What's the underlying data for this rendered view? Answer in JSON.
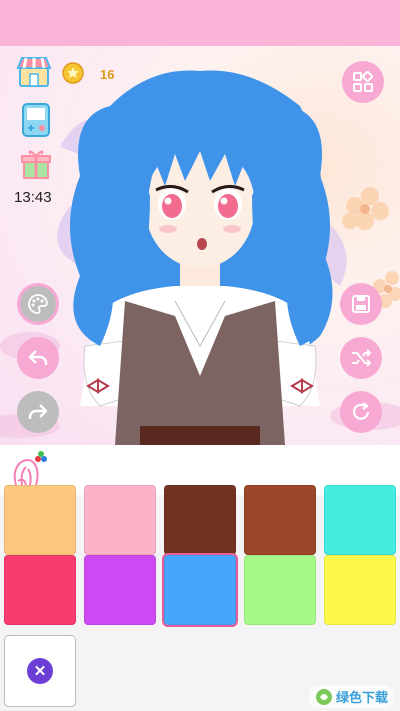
{
  "hud": {
    "coins": "16",
    "time": "13:43"
  },
  "colors": {
    "top_bar": "#fbb3d8",
    "button_pink": "#f7a9d3",
    "button_gray": "#bdbdbd",
    "hair": "#3f94ea"
  },
  "toolbar": {
    "active_tool": "hair-color-icon"
  },
  "palette": {
    "swatches": [
      {
        "color": "#fdc77d"
      },
      {
        "color": "#fdb2c8"
      },
      {
        "color": "#723220"
      },
      {
        "color": "#9c452a"
      },
      {
        "color": "#44ece0"
      },
      {
        "color": "#f73b6e"
      },
      {
        "color": "#cf4af5"
      },
      {
        "color": "#45a6fb"
      },
      {
        "color": "#a6f889"
      },
      {
        "color": "#fdf94b"
      }
    ],
    "selected_index": 7
  },
  "watermark": {
    "text": "绿色下载"
  }
}
